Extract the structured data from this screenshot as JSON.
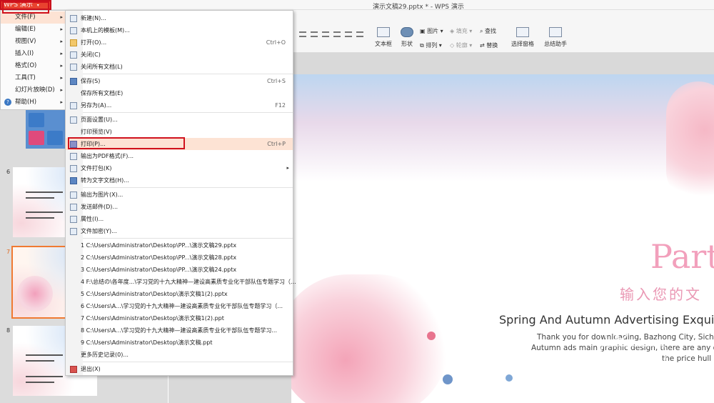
{
  "titlebar": {
    "app_button": "WPS 演示",
    "document_title": "演示文稿29.pptx * - WPS 演示"
  },
  "left_menu": {
    "items": [
      {
        "label": "文件(F)",
        "submenu": true
      },
      {
        "label": "编辑(E)",
        "submenu": true
      },
      {
        "label": "视图(V)",
        "submenu": true
      },
      {
        "label": "插入(I)",
        "submenu": true
      },
      {
        "label": "格式(O)",
        "submenu": true
      },
      {
        "label": "工具(T)",
        "submenu": true
      },
      {
        "label": "幻灯片放映(D)",
        "submenu": true
      },
      {
        "label": "帮助(H)",
        "submenu": true
      }
    ]
  },
  "file_menu": {
    "items": [
      {
        "label": "新建(N)...",
        "shortcut": ""
      },
      {
        "label": "本机上的模板(M)...",
        "shortcut": ""
      },
      {
        "label": "打开(O)...",
        "shortcut": "Ctrl+O"
      },
      {
        "label": "关闭(C)",
        "shortcut": ""
      },
      {
        "label": "关闭所有文档(L)",
        "shortcut": ""
      },
      {
        "label": "保存(S)",
        "shortcut": "Ctrl+S"
      },
      {
        "label": "保存所有文档(E)",
        "shortcut": ""
      },
      {
        "label": "另存为(A)...",
        "shortcut": "F12"
      },
      {
        "label": "页面设置(U)...",
        "shortcut": ""
      },
      {
        "label": "打印预览(V)",
        "shortcut": ""
      },
      {
        "label": "打印(P)...",
        "shortcut": "Ctrl+P"
      },
      {
        "label": "输出为PDF格式(F)...",
        "shortcut": ""
      },
      {
        "label": "文件打包(K)",
        "shortcut": ""
      },
      {
        "label": "转为文字文档(H)...",
        "shortcut": ""
      },
      {
        "label": "输出为图片(X)...",
        "shortcut": ""
      },
      {
        "label": "发送邮件(D)...",
        "shortcut": ""
      },
      {
        "label": "属性(I)...",
        "shortcut": ""
      },
      {
        "label": "文件加密(Y)...",
        "shortcut": ""
      }
    ],
    "recent": [
      "1 C:\\Users\\Administrator\\Desktop\\PP...\\演示文稿29.pptx",
      "2 C:\\Users\\Administrator\\Desktop\\PP...\\演示文稿28.pptx",
      "3 C:\\Users\\Administrator\\Desktop\\PP...\\演示文稿24.pptx",
      "4 F:\\总结の\\各年度...\\学习党的十九大精神—建设高素质专业化干部队伍专题学习（...",
      "5 C:\\Users\\Administrator\\Desktop\\演示文稿1(2).pptx",
      "6 C:\\Users\\A...\\学习党的十九大精神—建设高素质专业化干部队伍专题学习（...",
      "7 C:\\Users\\Administrator\\Desktop\\演示文稿1(2).ppt",
      "8 C:\\Users\\A...\\学习党的十九大精神—建设高素质专业化干部队伍专题学习...",
      "9 C:\\Users\\Administrator\\Desktop\\演示文稿.ppt"
    ],
    "more_history": "更多历史记录(0)...",
    "exit": "退出(X)"
  },
  "toolbar": {
    "textbox": "文本框",
    "shape": "形状",
    "picture": "图片",
    "fill": "填充",
    "arrange": "排列",
    "outline": "轮廓",
    "find": "查找",
    "replace": "替换",
    "select_pane": "选择窗格",
    "summary_assistant": "总结助手"
  },
  "thumbnails": {
    "numbers": [
      "6",
      "7",
      "8"
    ]
  },
  "slide": {
    "part_title": "Part",
    "cn_subtitle": "输入您的文",
    "en_title": "Spring And Autumn Advertising Exquisite",
    "body_lines": [
      "Thank you for downloading, Bazhong City, Sichuan Pro",
      "Autumn ads main graphic design, there are any question",
      "the price hull my b"
    ]
  },
  "accent_colors": {
    "wps_red": "#e8432f",
    "highlight_red": "#d0121d",
    "menu_hover": "#fde3d4",
    "pink_title": "#f2a0bc"
  }
}
